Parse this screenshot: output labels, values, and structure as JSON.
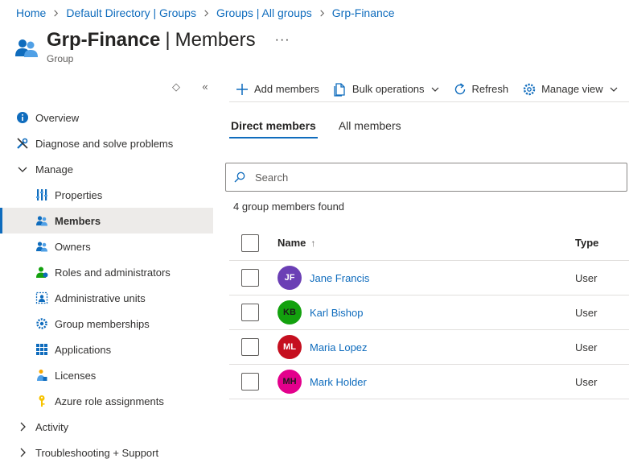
{
  "breadcrumb": [
    "Home",
    "Default Directory | Groups",
    "Groups | All groups",
    "Grp-Finance"
  ],
  "header": {
    "title": "Grp-Finance",
    "separator": "|",
    "section": "Members",
    "subtitle": "Group",
    "more": "···"
  },
  "sidebar": {
    "controls": {
      "expand": "◇",
      "collapse": "«"
    },
    "overview": "Overview",
    "diagnose": "Diagnose and solve problems",
    "manage": "Manage",
    "manage_items": [
      "Properties",
      "Members",
      "Owners",
      "Roles and administrators",
      "Administrative units",
      "Group memberships",
      "Applications",
      "Licenses",
      "Azure role assignments"
    ],
    "activity": "Activity",
    "troubleshooting": "Troubleshooting + Support"
  },
  "toolbar": {
    "add": "Add members",
    "bulk": "Bulk operations",
    "refresh": "Refresh",
    "manage_view": "Manage view"
  },
  "tabs": [
    "Direct members",
    "All members"
  ],
  "search": {
    "placeholder": "Search"
  },
  "count_text": "4 group members found",
  "table": {
    "headers": {
      "name": "Name",
      "sort": "↑",
      "type": "Type"
    },
    "rows": [
      {
        "initials": "JF",
        "name": "Jane Francis",
        "type": "User",
        "color": "#6b3fb5"
      },
      {
        "initials": "KB",
        "name": "Karl Bishop",
        "type": "User",
        "color": "#13a10e"
      },
      {
        "initials": "ML",
        "name": "Maria Lopez",
        "type": "User",
        "color": "#c50f1f"
      },
      {
        "initials": "MH",
        "name": "Mark Holder",
        "type": "User",
        "color": "#e3008c"
      }
    ]
  },
  "colors": {
    "accent": "#0f6cbd",
    "active_bg": "#edebe9"
  }
}
